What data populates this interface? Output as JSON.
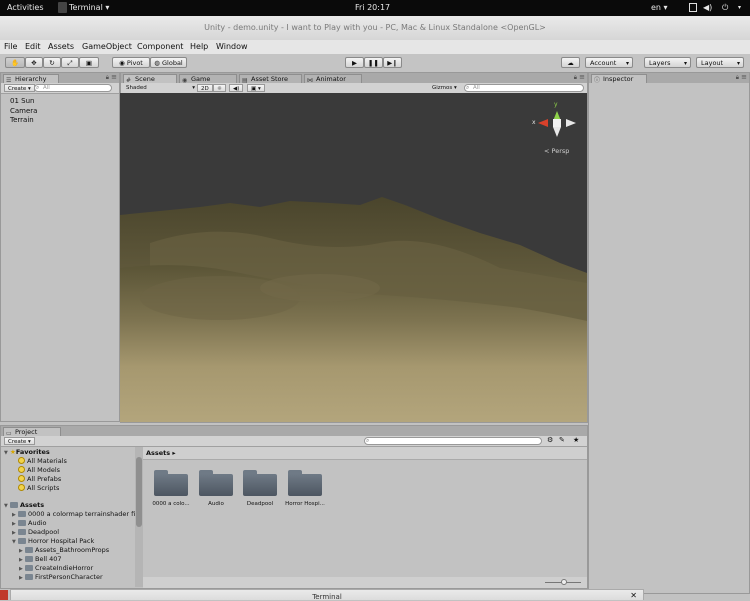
{
  "topbar": {
    "activities": "Activities",
    "app": "Terminal",
    "clock": "Fri 20:17",
    "lang": "en"
  },
  "window": {
    "title": "Unity - demo.unity - I want to Play with you - PC, Mac & Linux Standalone <OpenGL>"
  },
  "menu": [
    "File",
    "Edit",
    "Assets",
    "GameObject",
    "Component",
    "Help",
    "Window"
  ],
  "toolbar": {
    "pivot": "Pivot",
    "global": "Global",
    "account": "Account",
    "layers": "Layers",
    "layout": "Layout"
  },
  "hierarchy": {
    "tab": "Hierarchy",
    "create": "Create",
    "search_placeholder": "All",
    "items": [
      "01 Sun",
      "Camera",
      "Terrain"
    ]
  },
  "scene": {
    "tabs": [
      "Scene",
      "Game",
      "Asset Store",
      "Animator"
    ],
    "shading": "Shaded",
    "mode_2d": "2D",
    "gizmos": "Gizmos",
    "search_placeholder": "All",
    "gizmo": {
      "x": "x",
      "y": "y",
      "persp": "Persp"
    },
    "colors": {
      "sky": "#3a3a3a",
      "terrain_light": "#a89a72",
      "terrain_dark": "#3f3a26"
    }
  },
  "inspector": {
    "tab": "Inspector"
  },
  "project": {
    "tab": "Project",
    "create": "Create",
    "favorites_label": "Favorites",
    "favorites": [
      "All Materials",
      "All Models",
      "All Prefabs",
      "All Scripts"
    ],
    "assets_label": "Assets",
    "tree": [
      {
        "label": "0000 a colormap terrainshader fir",
        "indent": 1
      },
      {
        "label": "Audio",
        "indent": 1
      },
      {
        "label": "Deadpool",
        "indent": 1
      },
      {
        "label": "Horror Hospital Pack",
        "indent": 1
      },
      {
        "label": "Assets_BathroomProps",
        "indent": 2
      },
      {
        "label": "Bell 407",
        "indent": 2
      },
      {
        "label": "CreateIndieHorror",
        "indent": 2
      },
      {
        "label": "FirstPersonCharacter",
        "indent": 2
      }
    ],
    "breadcrumb": "Assets",
    "folders": [
      "0000 a colo...",
      "Audio",
      "Deadpool",
      "Horror Hospi..."
    ]
  },
  "terminal_window": {
    "title": "Terminal"
  }
}
